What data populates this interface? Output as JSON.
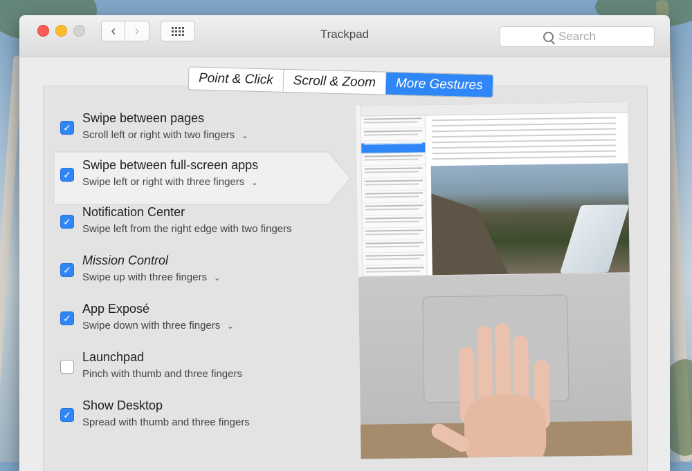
{
  "window": {
    "title": "Trackpad",
    "search_placeholder": "Search"
  },
  "tabs": [
    {
      "label": "Point & Click",
      "active": false
    },
    {
      "label": "Scroll & Zoom",
      "active": false
    },
    {
      "label": "More Gestures",
      "active": true
    }
  ],
  "gestures": [
    {
      "title": "Swipe between pages",
      "subtitle": "Scroll left or right with two fingers",
      "checked": true,
      "has_menu": true
    },
    {
      "title": "Swipe between full-screen apps",
      "subtitle": "Swipe left or right with three fingers",
      "checked": true,
      "has_menu": true
    },
    {
      "title": "Notification Center",
      "subtitle": "Swipe left from the right edge with two fingers",
      "checked": true,
      "has_menu": false
    },
    {
      "title": "Mission Control",
      "subtitle": "Swipe up with three fingers",
      "checked": true,
      "has_menu": true
    },
    {
      "title": "App Exposé",
      "subtitle": "Swipe down with three fingers",
      "checked": true,
      "has_menu": true
    },
    {
      "title": "Launchpad",
      "subtitle": "Pinch with thumb and three fingers",
      "checked": false,
      "has_menu": false
    },
    {
      "title": "Show Desktop",
      "subtitle": "Spread with thumb and three fingers",
      "checked": true,
      "has_menu": false
    }
  ],
  "colors": {
    "accent": "#2f86f6"
  },
  "icons": {
    "back": "chevron-left-icon",
    "forward": "chevron-right-icon",
    "show_all": "grid-icon",
    "search": "search-icon",
    "check": "checkmark-icon",
    "menu": "chevron-down-icon"
  }
}
